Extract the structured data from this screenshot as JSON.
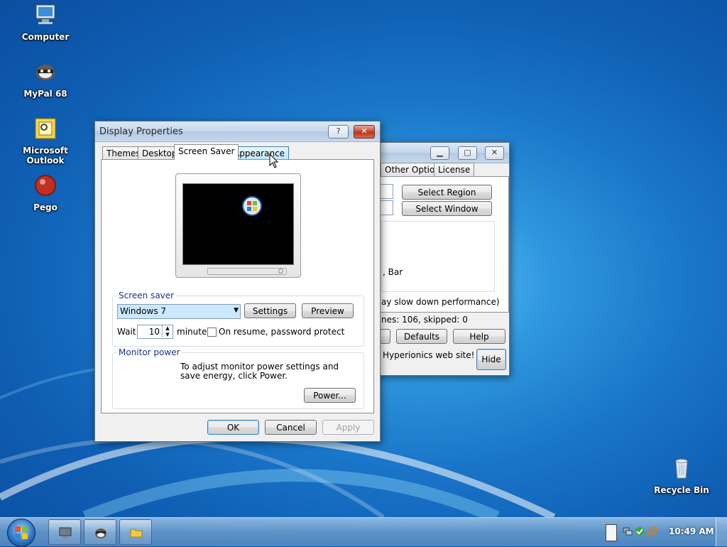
{
  "desktop": {
    "icons": [
      {
        "label": "Computer",
        "icon": "computer-icon"
      },
      {
        "label": "MyPal 68",
        "icon": "mypal-icon"
      },
      {
        "label": "Microsoft Outlook",
        "icon": "outlook-icon"
      },
      {
        "label": "Pego",
        "icon": "pego-icon"
      },
      {
        "label": "Recycle Bin",
        "icon": "recycle-bin-icon"
      }
    ]
  },
  "display_properties": {
    "title": "Display Properties",
    "help_button": "?",
    "close_button": "✕",
    "tabs": [
      "Themes",
      "Desktop",
      "Screen Saver",
      "Appearance"
    ],
    "active_tab": "Screen Saver",
    "screen_saver_group": "Screen saver",
    "screen_saver_selected": "Windows 7",
    "settings_button": "Settings",
    "preview_button": "Preview",
    "wait_label": "Wait:",
    "wait_value": "10",
    "minutes_label": "minutes",
    "password_protect_label": "On resume, password protect",
    "password_protect_checked": false,
    "monitor_power_group": "Monitor power",
    "monitor_power_text": "To adjust monitor power settings and save energy, click Power.",
    "power_button": "Power...",
    "ok_button": "OK",
    "cancel_button": "Cancel",
    "apply_button": "Apply"
  },
  "back_window": {
    "tabs": [
      "Other Options",
      "License"
    ],
    "select_region_button": "Select Region",
    "select_window_button": "Select Window",
    "bar_text": ", Bar",
    "performance_text": "ay slow down performance)",
    "frames_text": "nes: 106, skipped: 0",
    "defaults_button": "Defaults",
    "help_button": "Help",
    "footer_text": "Hyperionics web site! Click",
    "hide_button": "Hide"
  },
  "taskbar": {
    "clock": "10:49 AM"
  },
  "colors": {
    "accent": "#3c7fb1",
    "group_label": "#1e3287",
    "selection": "#cce8ff"
  }
}
